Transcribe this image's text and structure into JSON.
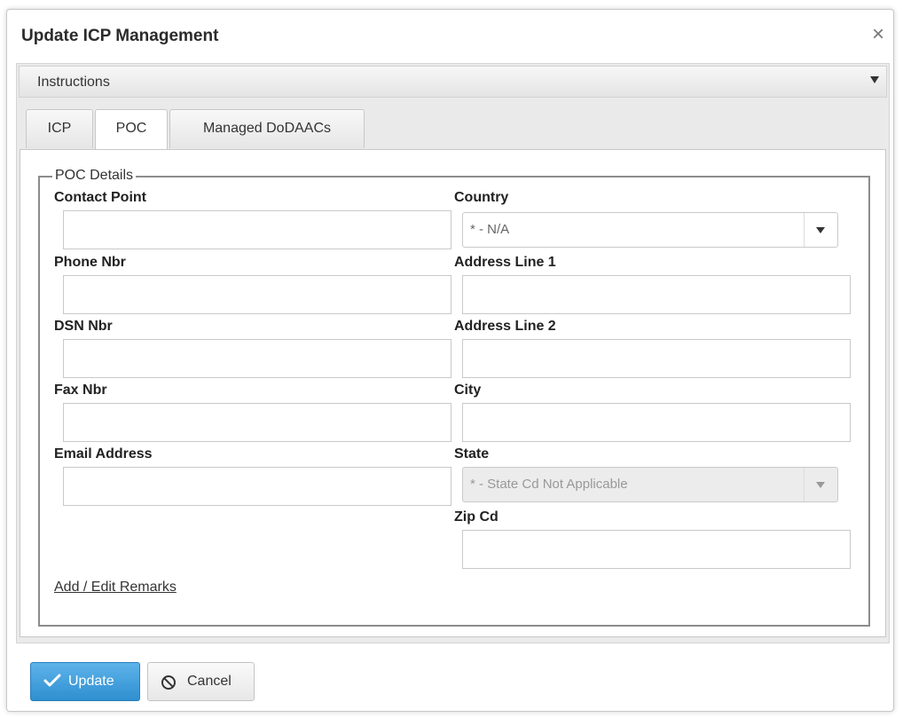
{
  "dialog": {
    "title": "Update ICP Management",
    "close_label": "×"
  },
  "instructions": {
    "label": "Instructions"
  },
  "tabs": [
    {
      "label": "ICP",
      "active": false
    },
    {
      "label": "POC",
      "active": true
    },
    {
      "label": "Managed DoDAACs",
      "active": false
    }
  ],
  "poc": {
    "legend": "POC Details",
    "contact_point": {
      "label": "Contact Point",
      "value": ""
    },
    "phone_nbr": {
      "label": "Phone Nbr",
      "value": ""
    },
    "dsn_nbr": {
      "label": "DSN Nbr",
      "value": ""
    },
    "fax_nbr": {
      "label": "Fax Nbr",
      "value": ""
    },
    "email_address": {
      "label": "Email Address",
      "value": ""
    },
    "country": {
      "label": "Country",
      "selected": "* - N/A"
    },
    "address_line_1": {
      "label": "Address Line 1",
      "value": ""
    },
    "address_line_2": {
      "label": "Address Line 2",
      "value": ""
    },
    "city": {
      "label": "City",
      "value": ""
    },
    "state": {
      "label": "State",
      "selected": "* - State Cd Not Applicable",
      "disabled": true
    },
    "zip_cd": {
      "label": "Zip Cd",
      "value": ""
    },
    "remarks_link": "Add / Edit Remarks"
  },
  "footer": {
    "update_label": "Update",
    "cancel_label": "Cancel"
  },
  "colors": {
    "primary_button": "#3a9be0",
    "fieldset_border": "#8c8c8c"
  }
}
